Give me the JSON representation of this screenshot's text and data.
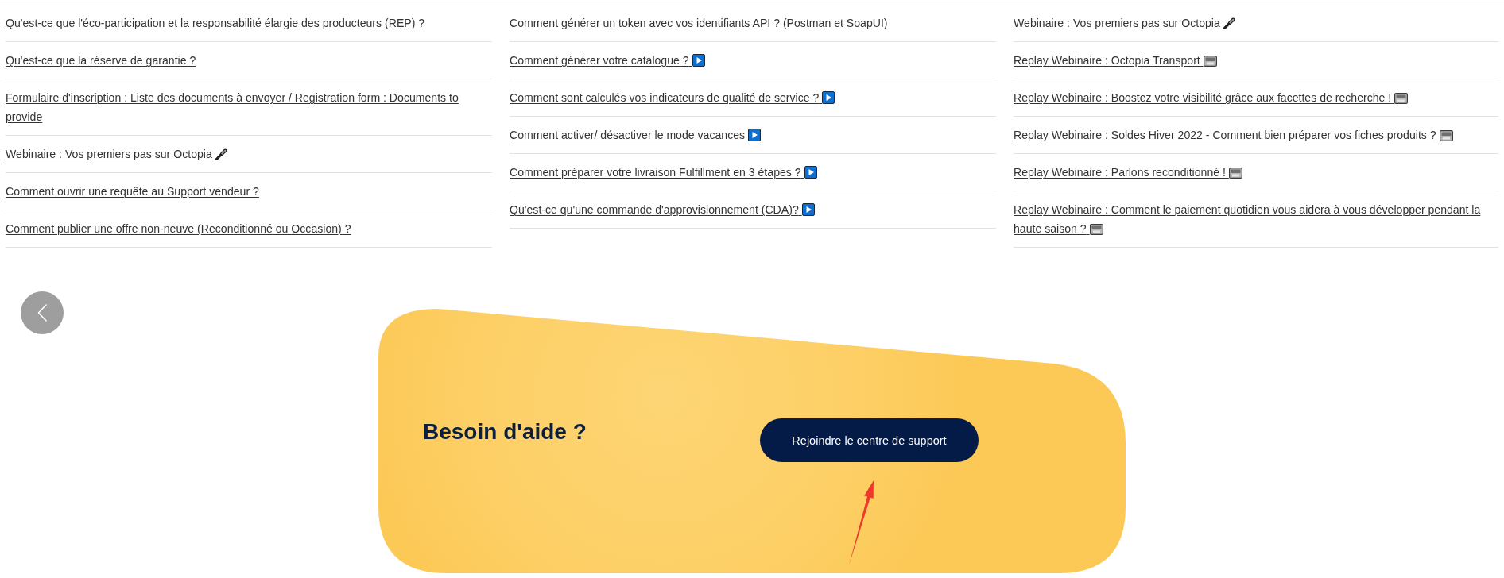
{
  "columns": [
    {
      "links": [
        {
          "text": "Qu'est-ce que l'éco-participation et la responsabilité élargie des producteurs (REP) ?",
          "kind": "plain"
        },
        {
          "text": "Qu'est-ce que la réserve de garantie ?",
          "kind": "plain"
        },
        {
          "text": "Formulaire d'inscription : Liste des documents à envoyer / Registration form : Documents to provide",
          "kind": "plain"
        },
        {
          "text": "Webinaire : Vos premiers pas sur Octopia",
          "kind": "webinar"
        },
        {
          "text": "Comment ouvrir une requête au Support vendeur ?",
          "kind": "plain"
        },
        {
          "text": "Comment publier une offre non-neuve (Reconditionné ou Occasion) ?",
          "kind": "plain"
        }
      ]
    },
    {
      "links": [
        {
          "text": "Comment générer un token avec vos identifiants API ? (Postman et SoapUI)",
          "kind": "plain"
        },
        {
          "text": "Comment générer votre catalogue ?",
          "kind": "video"
        },
        {
          "text": "Comment sont calculés vos indicateurs de qualité de service ?",
          "kind": "video"
        },
        {
          "text": "Comment activer/ désactiver le mode vacances",
          "kind": "video"
        },
        {
          "text": "Comment préparer votre livraison Fulfillment en 3 étapes ?",
          "kind": "video"
        },
        {
          "text": "Qu'est-ce qu'une commande d'approvisionnement (CDA)?",
          "kind": "video"
        }
      ]
    },
    {
      "links": [
        {
          "text": "Webinaire : Vos premiers pas sur Octopia",
          "kind": "webinar"
        },
        {
          "text": "Replay Webinaire : Octopia Transport",
          "kind": "replay"
        },
        {
          "text": "Replay Webinaire : Boostez votre visibilité grâce aux facettes de recherche !",
          "kind": "replay"
        },
        {
          "text": "Replay Webinaire : Soldes Hiver 2022 - Comment bien préparer vos fiches produits ?",
          "kind": "replay"
        },
        {
          "text": "Replay Webinaire : Parlons reconditionné !",
          "kind": "replay"
        },
        {
          "text": "Replay Webinaire : Comment le paiement quotidien vous aidera à vous développer pendant la haute saison ?",
          "kind": "replay"
        }
      ]
    }
  ],
  "help": {
    "title": "Besoin d'aide ?",
    "button": "Rejoindre le centre de support"
  }
}
